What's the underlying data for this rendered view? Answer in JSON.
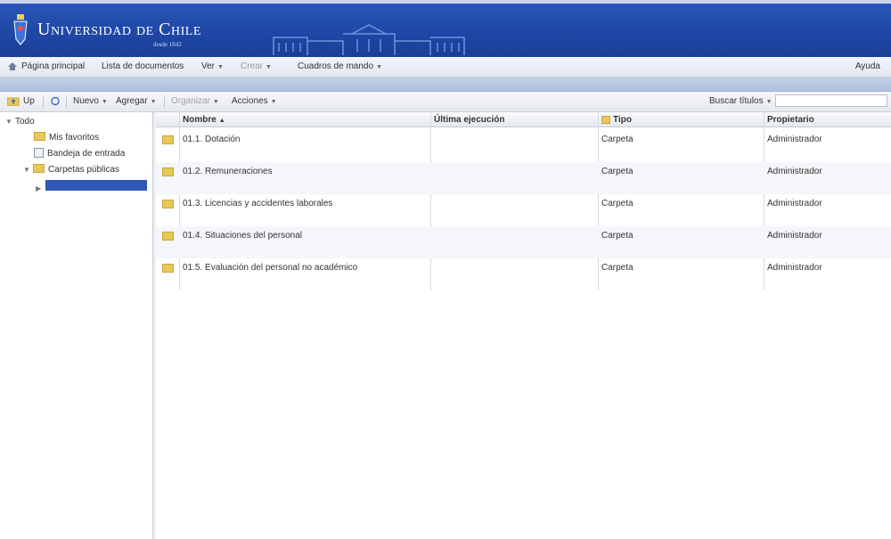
{
  "banner": {
    "logo_text": "Universidad de Chile",
    "logo_sub": "desde 1842"
  },
  "menubar": {
    "items": [
      {
        "label": "Página principal",
        "has_caret": false,
        "dim": false
      },
      {
        "label": "Lista de documentos",
        "has_caret": false,
        "dim": false
      },
      {
        "label": "Ver",
        "has_caret": true,
        "dim": false
      },
      {
        "label": "Crear",
        "has_caret": true,
        "dim": true
      },
      {
        "label": "Cuadros de mando",
        "has_caret": true,
        "dim": false
      }
    ],
    "right": "Ayuda"
  },
  "toolbar": {
    "up_label": "Up",
    "new_label": "Nuevo",
    "add_label": "Agregar",
    "organize_label": "Organizar",
    "actions_label": "Acciones",
    "search_label": "Buscar títulos",
    "search_value": ""
  },
  "tree": {
    "root": "Todo",
    "children": [
      {
        "label": "Mis favoritos",
        "kind": "folder"
      },
      {
        "label": "Bandeja de entrada",
        "kind": "doc"
      },
      {
        "label": "Carpetas públicas",
        "kind": "folder"
      }
    ],
    "selected_label": ""
  },
  "grid": {
    "columns": [
      "Nombre",
      "Última ejecución",
      "Tipo",
      "Propietario"
    ],
    "rows": [
      {
        "name": "01.1. Dotación",
        "last_run": "",
        "type": "Carpeta",
        "owner": "Administrador"
      },
      {
        "name": "01.2. Remuneraciones",
        "last_run": "",
        "type": "Carpeta",
        "owner": "Administrador"
      },
      {
        "name": "01.3. Licencias y accidentes laborales",
        "last_run": "",
        "type": "Carpeta",
        "owner": "Administrador"
      },
      {
        "name": "01.4. Situaciones del personal",
        "last_run": "",
        "type": "Carpeta",
        "owner": "Administrador"
      },
      {
        "name": "01.5. Evaluación del personal no académico",
        "last_run": "",
        "type": "Carpeta",
        "owner": "Administrador"
      }
    ]
  },
  "colors": {
    "banner": "#1e47a6",
    "selection": "#2f57b3",
    "folder": "#e8c85a"
  }
}
